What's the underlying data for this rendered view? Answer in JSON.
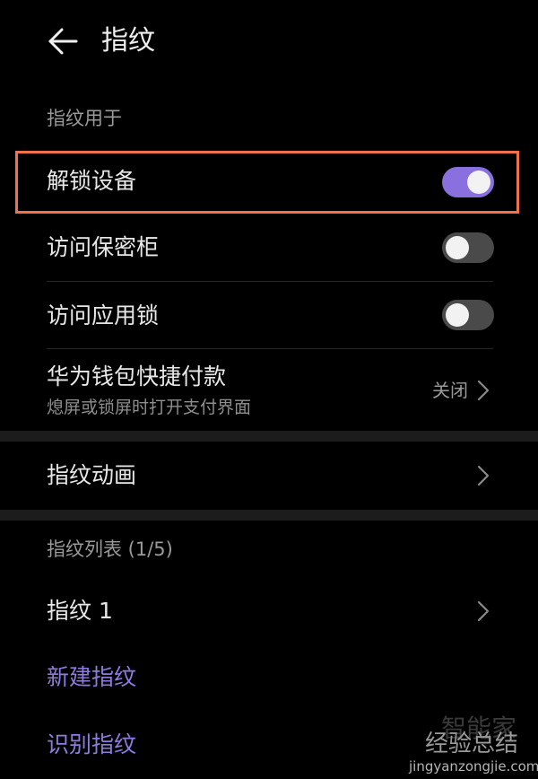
{
  "header": {
    "title": "指纹",
    "back_icon": "arrow-left-icon"
  },
  "fingerprint_use": {
    "section_label": "指纹用于",
    "items": [
      {
        "label": "解锁设备",
        "toggle_on": true
      },
      {
        "label": "访问保密柜",
        "toggle_on": false
      },
      {
        "label": "访问应用锁",
        "toggle_on": false
      }
    ],
    "wallet": {
      "label": "华为钱包快捷付款",
      "sub": "熄屏或锁屏时打开支付界面",
      "value": "关闭"
    }
  },
  "animation": {
    "label": "指纹动画"
  },
  "fingerprint_list": {
    "section_label": "指纹列表 (1/5)",
    "items": [
      {
        "label": "指纹 1"
      }
    ],
    "new_label": "新建指纹",
    "identify_label": "识别指纹"
  },
  "watermark": {
    "line1": "智能家",
    "line2": "经验总结",
    "line3": "jingyanzongjie.com"
  },
  "colors": {
    "accent": "#8a6fdf",
    "toggle_off_track": "#4a4a4a",
    "highlight": "#f1714a",
    "link": "#8f7be0"
  }
}
